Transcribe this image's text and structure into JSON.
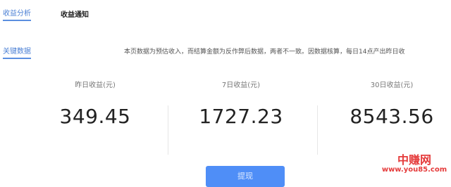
{
  "sidebar": {
    "items": [
      {
        "label": "收益分析"
      },
      {
        "label": "关键数据"
      }
    ]
  },
  "header": {
    "title": "收益通知"
  },
  "notice": {
    "text": "本页数据为预估收入，而结算金额为反作弊后数据，两者不一致。因数据核算，每日14点产出昨日收"
  },
  "stats": [
    {
      "label": "昨日收益(元)",
      "value": "349.45"
    },
    {
      "label": "7日收益(元)",
      "value": "1727.23"
    },
    {
      "label": "30日收益(元)",
      "value": "8543.56"
    }
  ],
  "button": {
    "label": "提现"
  },
  "watermark": {
    "name": "中赚网",
    "url": "www.you85.com",
    "color": "#e53b3b"
  },
  "colors": {
    "accent": "#4a7fd4",
    "button": "#4f8ef7"
  }
}
